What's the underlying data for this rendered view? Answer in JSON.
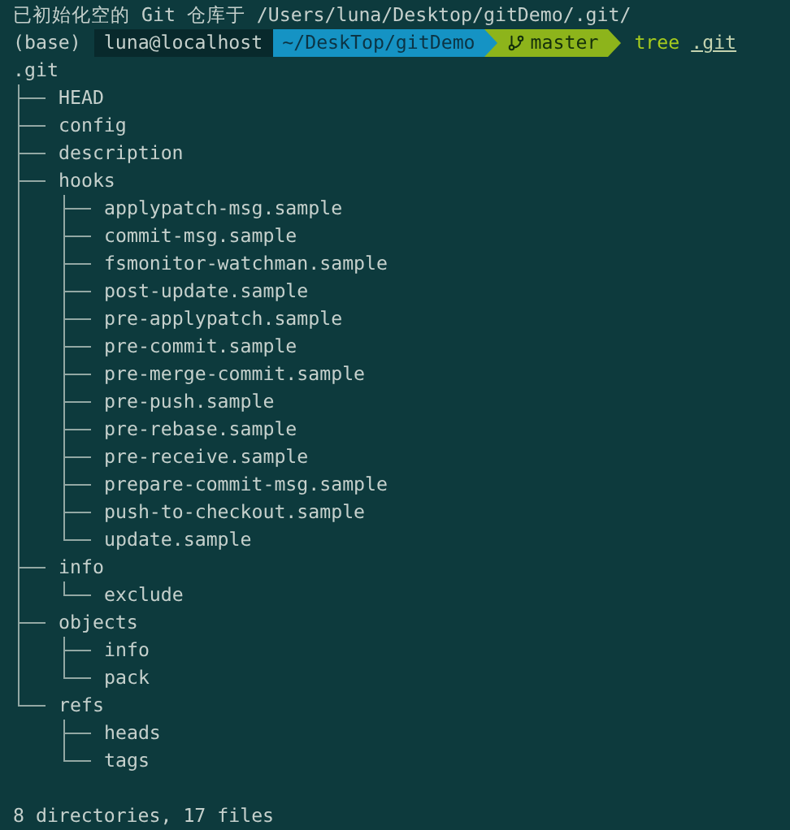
{
  "header": "已初始化空的 Git 仓库于 /Users/luna/Desktop/gitDemo/.git/",
  "prompt": {
    "env": "(base)",
    "segments": [
      {
        "kind": "host",
        "text": "luna@localhost"
      },
      {
        "kind": "path",
        "text": "~/DeskTop/gitDemo"
      },
      {
        "kind": "branch",
        "text": "master"
      }
    ],
    "command": "tree",
    "argument": ".git"
  },
  "tree": {
    "name": ".git",
    "children": [
      {
        "name": "HEAD"
      },
      {
        "name": "config"
      },
      {
        "name": "description"
      },
      {
        "name": "hooks",
        "children": [
          {
            "name": "applypatch-msg.sample"
          },
          {
            "name": "commit-msg.sample"
          },
          {
            "name": "fsmonitor-watchman.sample"
          },
          {
            "name": "post-update.sample"
          },
          {
            "name": "pre-applypatch.sample"
          },
          {
            "name": "pre-commit.sample"
          },
          {
            "name": "pre-merge-commit.sample"
          },
          {
            "name": "pre-push.sample"
          },
          {
            "name": "pre-rebase.sample"
          },
          {
            "name": "pre-receive.sample"
          },
          {
            "name": "prepare-commit-msg.sample"
          },
          {
            "name": "push-to-checkout.sample"
          },
          {
            "name": "update.sample"
          }
        ]
      },
      {
        "name": "info",
        "children": [
          {
            "name": "exclude"
          }
        ]
      },
      {
        "name": "objects",
        "children": [
          {
            "name": "info"
          },
          {
            "name": "pack"
          }
        ]
      },
      {
        "name": "refs",
        "children": [
          {
            "name": "heads"
          },
          {
            "name": "tags"
          }
        ]
      }
    ]
  },
  "summary": "8 directories, 17 files"
}
